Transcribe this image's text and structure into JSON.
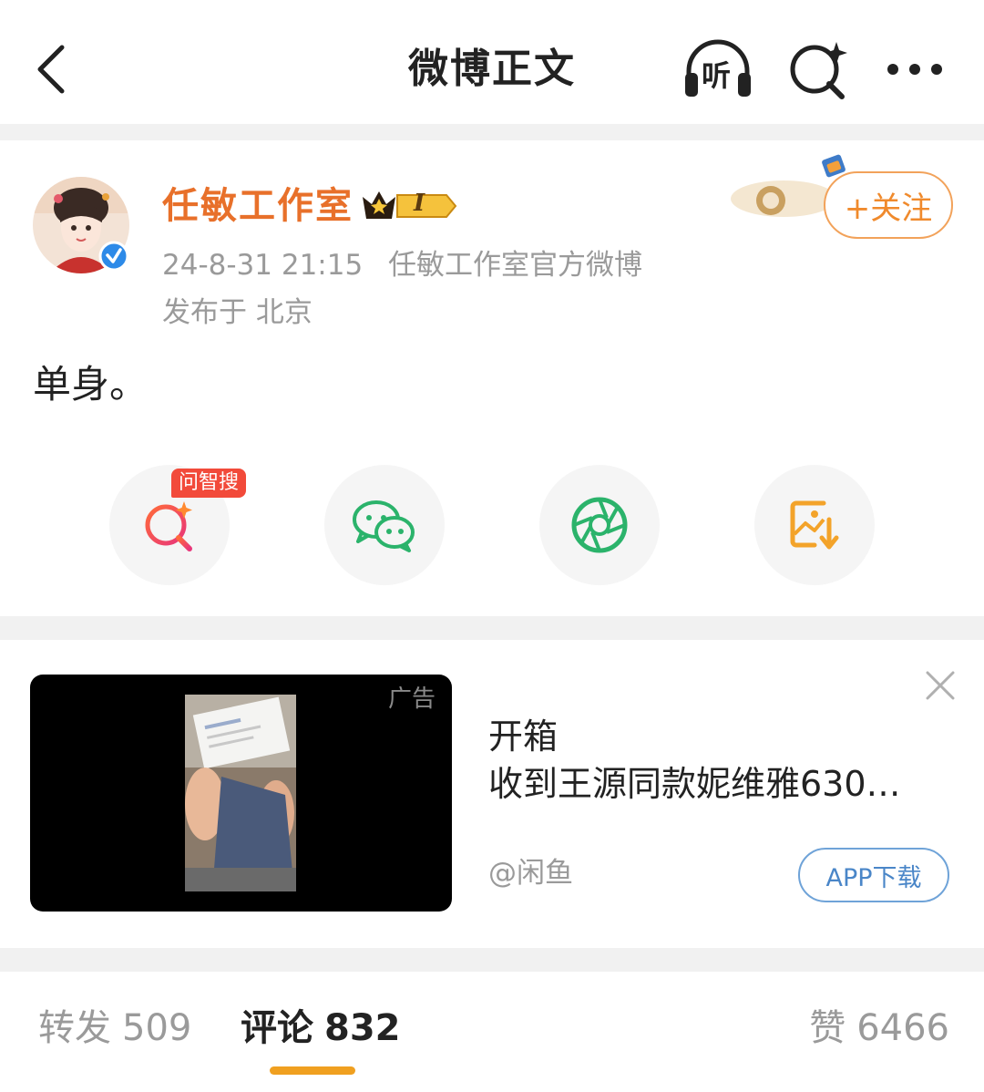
{
  "header": {
    "title": "微博正文",
    "listen_label": "听"
  },
  "post": {
    "author": "任敏工作室",
    "vip_level": "I",
    "timestamp": "24-8-31 21:15",
    "source": "任敏工作室官方微博",
    "location": "发布于 北京",
    "follow_label": "+关注",
    "text": "单身。"
  },
  "share": {
    "ai_badge": "问智搜",
    "items": [
      "ai-search",
      "wechat",
      "moments",
      "save-image"
    ]
  },
  "ad": {
    "label": "广告",
    "title": "开箱",
    "description": "收到王源同款妮维雅630…",
    "source": "@闲鱼",
    "cta": "APP下载"
  },
  "tabs": {
    "repost_label": "转发",
    "repost_count": "509",
    "comment_label": "评论",
    "comment_count": "832",
    "like_label": "赞",
    "like_count": "6466"
  },
  "colors": {
    "accent_orange": "#f08a2c",
    "author_orange": "#e8702a",
    "tab_indicator": "#f0a020",
    "cta_blue": "#4a86c8",
    "badge_red": "#f24a3a"
  }
}
